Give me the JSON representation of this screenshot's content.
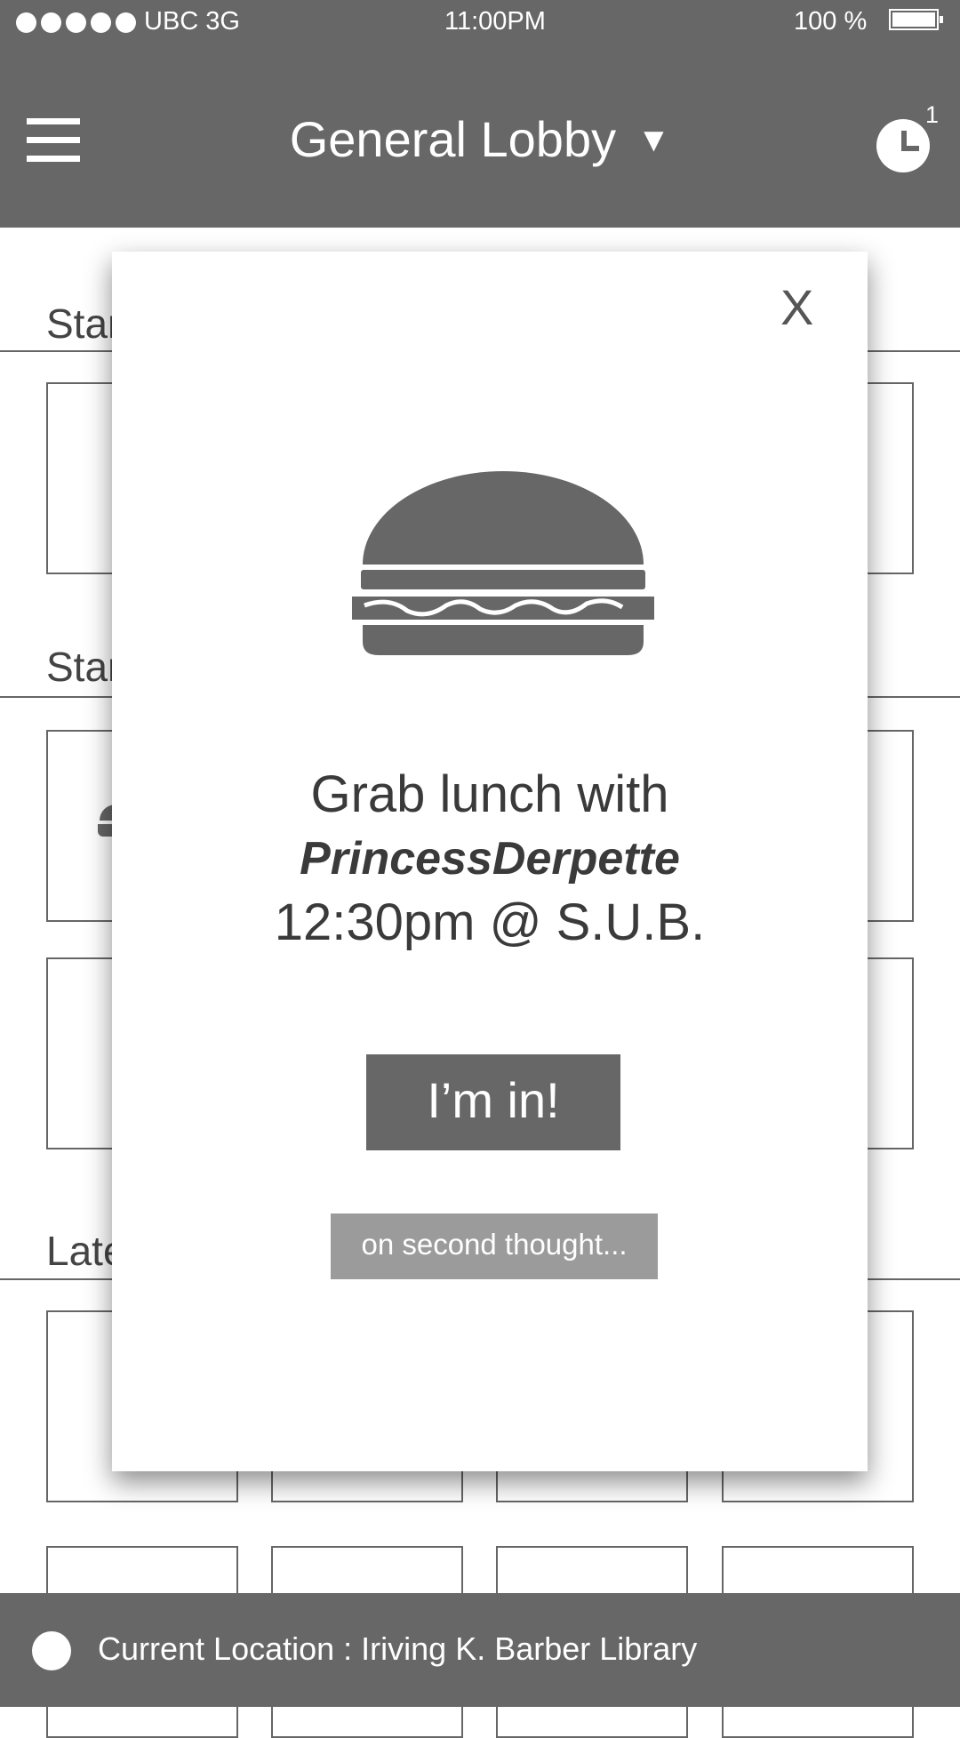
{
  "status_bar": {
    "carrier": "UBC  3G",
    "time": "11:00PM",
    "battery": "100 %"
  },
  "header": {
    "title": "General Lobby",
    "caret": "▼",
    "notification_count": "1"
  },
  "sections": [
    {
      "title": "Star"
    },
    {
      "title": "Star"
    },
    {
      "title": "Late"
    }
  ],
  "modal": {
    "close_label": "X",
    "icon": "burger-icon",
    "line1": "Grab lunch with",
    "line2": "PrincessDerpette",
    "line3": "12:30pm @ S.U.B.",
    "confirm_label": "I’m in!",
    "decline_label": "on second thought..."
  },
  "footer": {
    "location_text": "Current Location : Iriving K. Barber Library"
  },
  "colors": {
    "bar": "#676767",
    "secondary_button": "#9b9b9b",
    "text": "#444444"
  }
}
